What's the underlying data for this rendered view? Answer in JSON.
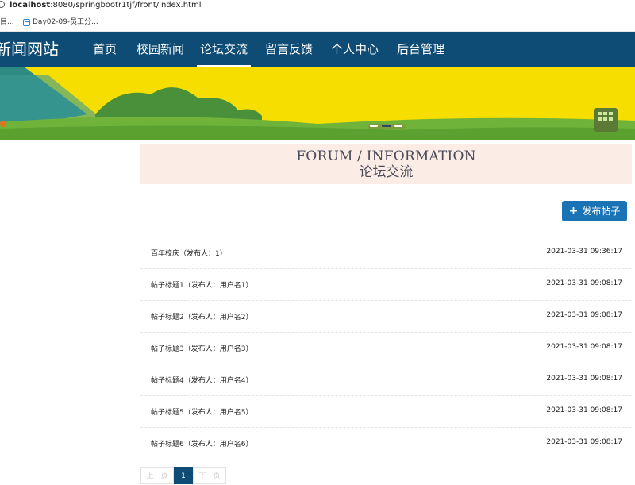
{
  "browser": {
    "url_host": "localhost",
    "url_rest": ":8080/springbootr1tjf/front/index.html",
    "bookmarks": [
      "目...",
      "Day02-09-员工分..."
    ]
  },
  "navbar": {
    "site_title": "新闻网站",
    "items": [
      {
        "label": "首页"
      },
      {
        "label": "校园新闻"
      },
      {
        "label": "论坛交流",
        "active": true
      },
      {
        "label": "留言反馈"
      },
      {
        "label": "个人中心"
      },
      {
        "label": "后台管理"
      }
    ]
  },
  "section": {
    "title_en": "FORUM / INFORMATION",
    "title_cn": "论坛交流"
  },
  "post_button": {
    "label": "发布帖子",
    "icon": "plus-icon"
  },
  "posts": [
    {
      "title": "百年校庆（发布人：1）",
      "time": "2021-03-31 09:36:17"
    },
    {
      "title": "帖子标题1（发布人：用户名1）",
      "time": "2021-03-31 09:08:17"
    },
    {
      "title": "帖子标题2（发布人：用户名2）",
      "time": "2021-03-31 09:08:17"
    },
    {
      "title": "帖子标题3（发布人：用户名3）",
      "time": "2021-03-31 09:08:17"
    },
    {
      "title": "帖子标题4（发布人：用户名4）",
      "time": "2021-03-31 09:08:17"
    },
    {
      "title": "帖子标题5（发布人：用户名5）",
      "time": "2021-03-31 09:08:17"
    },
    {
      "title": "帖子标题6（发布人：用户名6）",
      "time": "2021-03-31 09:08:17"
    }
  ],
  "pagination": {
    "prev": "上一页",
    "current": "1",
    "next": "下一页"
  },
  "colors": {
    "nav": "#0f4c75",
    "accent": "#1a73b5",
    "header_bg": "#fbece6"
  }
}
